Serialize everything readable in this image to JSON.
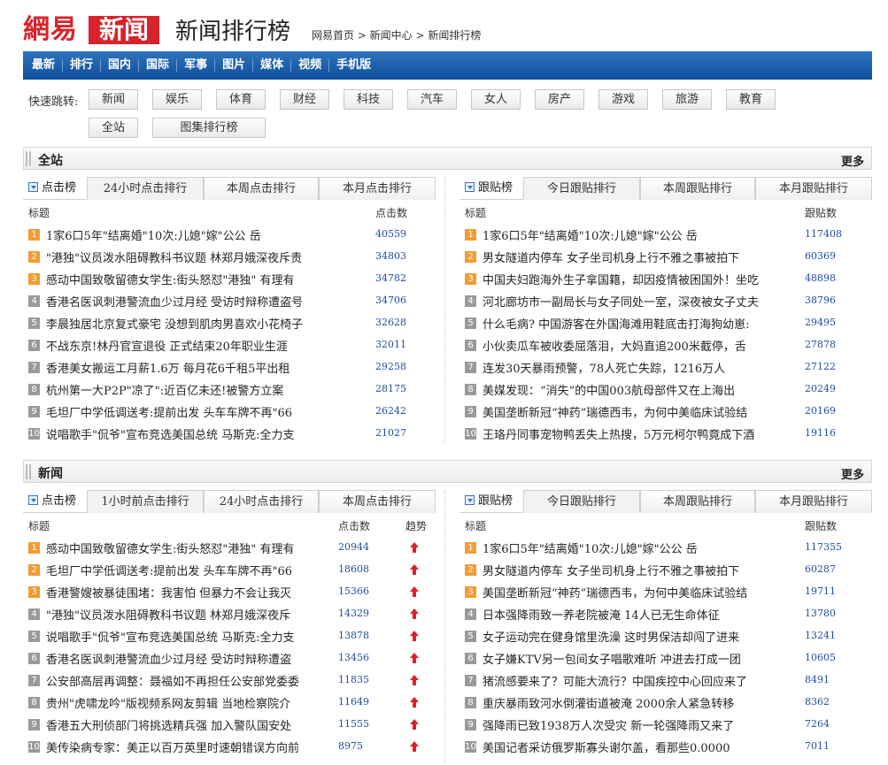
{
  "header": {
    "logo_text": "網易",
    "logo_news": "新闻",
    "title": "新闻排行榜",
    "breadcrumb": "网易首页 > 新闻中心 > 新闻排行榜"
  },
  "nav": [
    "最新",
    "排行",
    "国内",
    "国际",
    "军事",
    "图片",
    "媒体",
    "视频",
    "手机版"
  ],
  "quick": {
    "label": "快速跳转:",
    "row1": [
      "新闻",
      "娱乐",
      "体育",
      "财经",
      "科技",
      "汽车",
      "女人",
      "房产",
      "游戏",
      "旅游",
      "教育"
    ],
    "row2": [
      "全站",
      "图集排行榜"
    ]
  },
  "sections": [
    {
      "title": "全站",
      "more": "更多",
      "left": {
        "head": "点击榜",
        "tabs": [
          "24小时点击排行",
          "本周点击排行",
          "本月点击排行"
        ],
        "col_title": "标题",
        "col_count": "点击数",
        "rows": [
          {
            "n": "1",
            "t": "1家6口5年\"结离婚\"10次:儿媳\"嫁\"公公 岳",
            "c": "40559"
          },
          {
            "n": "2",
            "t": "\"港独\"议员泼水阻碍教科书议题 林郑月娥深夜斥责",
            "c": "34803"
          },
          {
            "n": "3",
            "t": "感动中国致敬留德女学生:街头怒怼\"港独\" 有理有",
            "c": "34782"
          },
          {
            "n": "4",
            "t": "香港名医讽刺港警流血少过月经 受访时辩称遭盗号",
            "c": "34706"
          },
          {
            "n": "5",
            "t": "李晨独居北京复式豪宅 没想到肌肉男喜欢小花椅子",
            "c": "32628"
          },
          {
            "n": "6",
            "t": "不战东京!林丹官宣退役 正式结束20年职业生涯",
            "c": "32011"
          },
          {
            "n": "7",
            "t": "香港美女搬运工月薪1.6万 每月花6千租5平出租",
            "c": "29258"
          },
          {
            "n": "8",
            "t": "杭州第一大P2P\"凉了\":近百亿未还!被警方立案",
            "c": "28175"
          },
          {
            "n": "9",
            "t": "毛坦厂中学低调送考:提前出发 头车车牌不再\"66",
            "c": "26242"
          },
          {
            "n": "10",
            "t": "说唱歌手\"侃爷\"宣布竞选美国总统 马斯克:全力支",
            "c": "21027"
          }
        ]
      },
      "right": {
        "head": "跟贴榜",
        "tabs": [
          "今日跟贴排行",
          "本周跟贴排行",
          "本月跟贴排行"
        ],
        "col_title": "标题",
        "col_count": "跟贴数",
        "rows": [
          {
            "n": "1",
            "t": "1家6口5年\"结离婚\"10次:儿媳\"嫁\"公公 岳",
            "c": "117408"
          },
          {
            "n": "2",
            "t": "男女隧道内停车 女子坐司机身上行不雅之事被拍下",
            "c": "60369"
          },
          {
            "n": "3",
            "t": "中国夫妇跑海外生子拿国籍，却因疫情被困国外！坐吃",
            "c": "48898"
          },
          {
            "n": "4",
            "t": "河北廊坊市一副局长与女子同处一室，深夜被女子丈夫",
            "c": "38796"
          },
          {
            "n": "5",
            "t": "什么毛病? 中国游客在外国海滩用鞋底击打海狗幼崽:",
            "c": "29495"
          },
          {
            "n": "6",
            "t": "小伙卖瓜车被收委屈落泪，大妈直追200米截停，舌",
            "c": "27878"
          },
          {
            "n": "7",
            "t": "连发30天暴雨预警，78人死亡失踪，1216万人",
            "c": "27122"
          },
          {
            "n": "8",
            "t": "美媒发现：“消失”的中国003航母部件又在上海出",
            "c": "20249"
          },
          {
            "n": "9",
            "t": "美国垄断新冠“神药”瑞德西韦，为何中美临床试验结",
            "c": "20169"
          },
          {
            "n": "10",
            "t": "王珞丹同事宠物鸭丢失上热搜，5万元柯尔鸭竟成下酒",
            "c": "19116"
          }
        ]
      }
    },
    {
      "title": "新闻",
      "more": "更多",
      "left": {
        "head": "点击榜",
        "tabs": [
          "1小时前点击排行",
          "24小时点击排行",
          "本周点击排行"
        ],
        "col_title": "标题",
        "col_count": "点击数",
        "col_trend": "趋势",
        "rows": [
          {
            "n": "1",
            "t": "感动中国致敬留德女学生:街头怒怼\"港独\" 有理有",
            "c": "20944"
          },
          {
            "n": "2",
            "t": "毛坦厂中学低调送考:提前出发 头车车牌不再\"66",
            "c": "18608"
          },
          {
            "n": "3",
            "t": "香港警嫂被暴徒围堵：我害怕 但暴力不会让我灭",
            "c": "15366"
          },
          {
            "n": "4",
            "t": "\"港独\"议员泼水阻碍教科书议题 林郑月娥深夜斥",
            "c": "14329"
          },
          {
            "n": "5",
            "t": "说唱歌手\"侃爷\"宣布竞选美国总统 马斯克:全力支",
            "c": "13878"
          },
          {
            "n": "6",
            "t": "香港名医讽刺港警流血少过月经 受访时辩称遭盗",
            "c": "13456"
          },
          {
            "n": "7",
            "t": "公安部高层再调整：聂福如不再担任公安部党委委",
            "c": "11835"
          },
          {
            "n": "8",
            "t": "贵州\"虎啸龙吟\"版视频系网友剪辑 当地检察院介",
            "c": "11649"
          },
          {
            "n": "9",
            "t": "香港五大刑侦部门将挑选精兵强 加入警队国安处",
            "c": "11555"
          },
          {
            "n": "10",
            "t": "美传染病专家：美正以百万英里时速朝错误方向前",
            "c": "8975"
          }
        ]
      },
      "right": {
        "head": "跟贴榜",
        "tabs": [
          "今日跟贴排行",
          "本周跟贴排行",
          "本月跟贴排行"
        ],
        "col_title": "标题",
        "col_count": "跟贴数",
        "rows": [
          {
            "n": "1",
            "t": "1家6口5年\"结离婚\"10次:儿媳\"嫁\"公公 岳",
            "c": "117355"
          },
          {
            "n": "2",
            "t": "男女隧道内停车 女子坐司机身上行不雅之事被拍下",
            "c": "60287"
          },
          {
            "n": "3",
            "t": "美国垄断新冠“神药”瑞德西韦，为何中美临床试验结",
            "c": "19711"
          },
          {
            "n": "4",
            "t": "日本强降雨致一养老院被淹 14人已无生命体征",
            "c": "13780"
          },
          {
            "n": "5",
            "t": "女子运动完在健身馆里洗澡 这时男保洁却闯了进来",
            "c": "13241"
          },
          {
            "n": "6",
            "t": "女子嫌KTV另一包间女子唱歌难听 冲进去打成一团",
            "c": "10605"
          },
          {
            "n": "7",
            "t": "猪流感要来了？可能大流行？中国疾控中心回应来了",
            "c": "8491"
          },
          {
            "n": "8",
            "t": "重庆暴雨致河水倒灌街道被淹 2000余人紧急转移",
            "c": "8362"
          },
          {
            "n": "9",
            "t": "强降雨已致1938万人次受灾 新一轮强降雨又来了",
            "c": "7264"
          },
          {
            "n": "10",
            "t": "美国记者采访俄罗斯寡头谢尔盖，看那些0.0000",
            "c": "7011"
          }
        ]
      }
    }
  ]
}
